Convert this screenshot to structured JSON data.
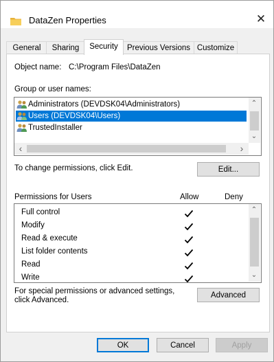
{
  "window": {
    "title": "DataZen Properties",
    "close_glyph": "✕"
  },
  "tabs": [
    "General",
    "Sharing",
    "Security",
    "Previous Versions",
    "Customize"
  ],
  "active_tab": "Security",
  "object": {
    "label": "Object name:",
    "value": "C:\\Program Files\\DataZen"
  },
  "groups": {
    "label": "Group or user names:",
    "items": [
      "Administrators (DEVDSK04\\Administrators)",
      "Users (DEVDSK04\\Users)",
      "TrustedInstaller"
    ],
    "selected_index": 1
  },
  "change_text": "To change permissions, click Edit.",
  "edit_button": "Edit...",
  "permissions": {
    "header_label": "Permissions for Users",
    "allow_label": "Allow",
    "deny_label": "Deny",
    "items": [
      {
        "name": "Full control",
        "allow": true,
        "deny": false
      },
      {
        "name": "Modify",
        "allow": true,
        "deny": false
      },
      {
        "name": "Read & execute",
        "allow": true,
        "deny": false
      },
      {
        "name": "List folder contents",
        "allow": true,
        "deny": false
      },
      {
        "name": "Read",
        "allow": true,
        "deny": false
      },
      {
        "name": "Write",
        "allow": true,
        "deny": false
      }
    ]
  },
  "special": {
    "line1": "For special permissions or advanced settings,",
    "line2": "click Advanced."
  },
  "advanced_button": "Advanced",
  "footer": {
    "ok": "OK",
    "cancel": "Cancel",
    "apply": "Apply"
  },
  "colors": {
    "selection": "#0078d7",
    "folder": "#f5c542"
  },
  "icons": {
    "title": "folder-icon",
    "users": "user-group-icon",
    "check": "checkmark-icon"
  }
}
